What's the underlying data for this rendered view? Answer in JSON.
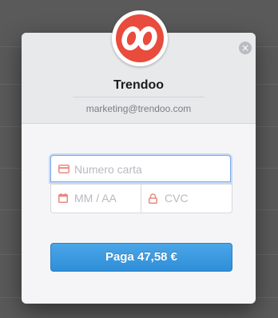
{
  "merchant": {
    "logo_text": "OO",
    "name": "Trendoo",
    "email": "marketing@trendoo.com"
  },
  "close_icon": "close-icon",
  "form": {
    "card_number_placeholder": "Numero carta",
    "expiry_placeholder": "MM / AA",
    "cvc_placeholder": "CVC"
  },
  "pay_button_label": "Paga 47,58 €",
  "colors": {
    "accent": "#3b9be0",
    "logo_red": "#e94b3c",
    "icon_red": "#e98a7e"
  }
}
